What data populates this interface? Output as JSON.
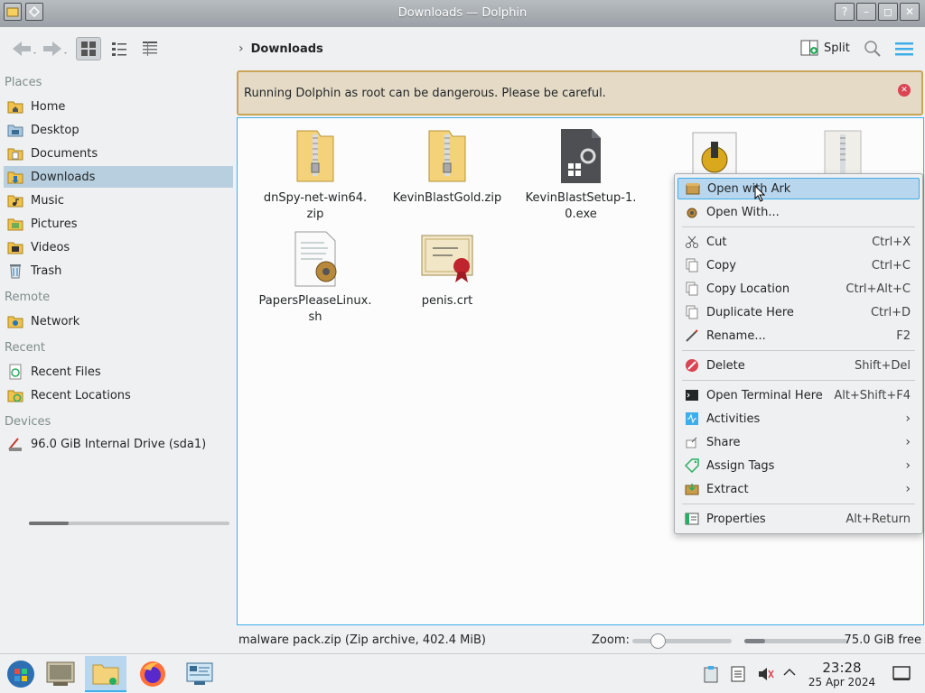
{
  "window": {
    "title": "Downloads — Dolphin"
  },
  "titlebar_buttons": {
    "help": "?",
    "minimize": "–",
    "maximize": "◻",
    "close": "✕"
  },
  "toolbar": {
    "breadcrumb": "Downloads",
    "split_label": "Split"
  },
  "sidebar": {
    "places_header": "Places",
    "places": [
      {
        "label": "Home",
        "icon": "home-folder-icon"
      },
      {
        "label": "Desktop",
        "icon": "desktop-icon"
      },
      {
        "label": "Documents",
        "icon": "documents-folder-icon"
      },
      {
        "label": "Downloads",
        "icon": "downloads-folder-icon"
      },
      {
        "label": "Music",
        "icon": "music-folder-icon"
      },
      {
        "label": "Pictures",
        "icon": "pictures-folder-icon"
      },
      {
        "label": "Videos",
        "icon": "videos-folder-icon"
      },
      {
        "label": "Trash",
        "icon": "trash-icon"
      }
    ],
    "remote_header": "Remote",
    "remote": [
      {
        "label": "Network",
        "icon": "network-folder-icon"
      }
    ],
    "recent_header": "Recent",
    "recent": [
      {
        "label": "Recent Files",
        "icon": "recent-files-icon"
      },
      {
        "label": "Recent Locations",
        "icon": "recent-locations-icon"
      }
    ],
    "devices_header": "Devices",
    "devices": [
      {
        "label": "96.0 GiB Internal Drive (sda1)",
        "icon": "hard-drive-icon",
        "used_fraction": 0.2
      }
    ]
  },
  "warning": {
    "message": "Running Dolphin as root can be dangerous. Please be careful."
  },
  "files": [
    {
      "name": "dnSpy-net-win64.\nzip",
      "line1": "dnSpy-net-win64.",
      "line2": "zip",
      "icon": "zip-archive-icon"
    },
    {
      "name": "KevinBlastGold.zip",
      "line1": "KevinBlastGold.zip",
      "line2": "",
      "icon": "zip-archive-icon"
    },
    {
      "name": "KevinBlastSetup-1.0.exe",
      "line1": "KevinBlastSetup-1.",
      "line2": "0.exe",
      "icon": "exe-file-icon"
    },
    {
      "name": "",
      "line1": "",
      "line2": "",
      "icon": "installer-package-icon"
    },
    {
      "name": "",
      "line1": "",
      "line2": "",
      "icon": "zip-archive-icon"
    },
    {
      "name": "PapersPleaseLinux.sh",
      "line1": "PapersPleaseLinux.",
      "line2": "sh",
      "icon": "shell-script-icon"
    },
    {
      "name": "penis.crt",
      "line1": "penis.crt",
      "line2": "",
      "icon": "certificate-icon"
    }
  ],
  "context_menu": {
    "items": [
      {
        "label": "Open with Ark",
        "shortcut": "",
        "icon": "ark-icon",
        "highlighted": true
      },
      {
        "label": "Open With...",
        "shortcut": "",
        "icon": "open-with-icon"
      },
      {
        "label": "Cut",
        "shortcut": "Ctrl+X",
        "icon": "cut-icon"
      },
      {
        "label": "Copy",
        "shortcut": "Ctrl+C",
        "icon": "copy-icon"
      },
      {
        "label": "Copy Location",
        "shortcut": "Ctrl+Alt+C",
        "icon": "copy-location-icon"
      },
      {
        "label": "Duplicate Here",
        "shortcut": "Ctrl+D",
        "icon": "duplicate-icon"
      },
      {
        "label": "Rename...",
        "shortcut": "F2",
        "icon": "rename-icon"
      },
      {
        "label": "Delete",
        "shortcut": "Shift+Del",
        "icon": "delete-icon"
      },
      {
        "label": "Open Terminal Here",
        "shortcut": "Alt+Shift+F4",
        "icon": "terminal-icon"
      },
      {
        "label": "Activities",
        "shortcut": "",
        "icon": "activities-icon",
        "submenu": true
      },
      {
        "label": "Share",
        "shortcut": "",
        "icon": "share-icon",
        "submenu": true
      },
      {
        "label": "Assign Tags",
        "shortcut": "",
        "icon": "tag-icon",
        "submenu": true
      },
      {
        "label": "Extract",
        "shortcut": "",
        "icon": "extract-icon",
        "submenu": true
      },
      {
        "label": "Properties",
        "shortcut": "Alt+Return",
        "icon": "properties-icon"
      }
    ]
  },
  "statusbar": {
    "selection": "malware pack.zip (Zip archive, 402.4 MiB)",
    "zoom_label": "Zoom:",
    "zoom_level": 0.22,
    "free_space": "75.0 GiB free",
    "used_fraction": 0.2
  },
  "taskbar": {
    "apps": [
      {
        "name": "start-menu-icon"
      },
      {
        "name": "terminal-app-icon"
      },
      {
        "name": "dolphin-app-icon",
        "active": true
      },
      {
        "name": "firefox-icon"
      },
      {
        "name": "system-settings-icon"
      }
    ],
    "time": "23:28",
    "date": "25 Apr 2024"
  },
  "colors": {
    "accent": "#3daee9",
    "selection": "#b8cfdf",
    "warning_bg": "#e4dac6",
    "warning_border": "#c9a55a",
    "danger": "#da4453"
  }
}
